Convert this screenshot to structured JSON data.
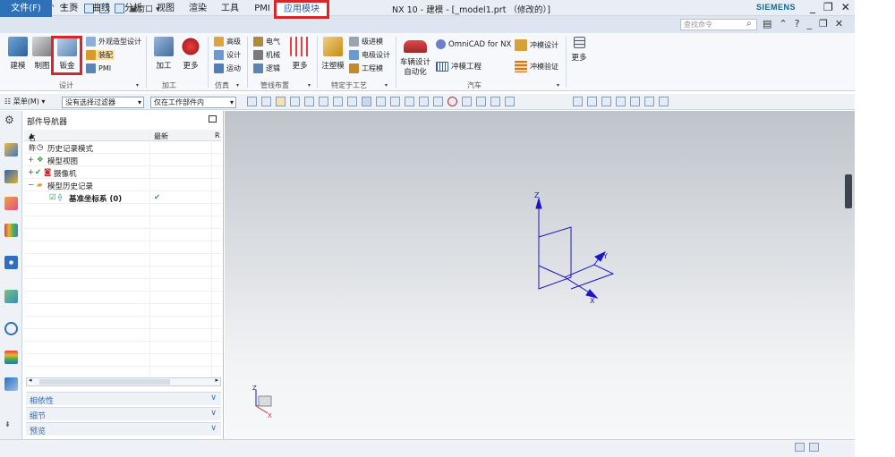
{
  "app": {
    "logo": "NX",
    "window_title": "NX 10 - 建模 - [_model1.prt （修改的）]",
    "brand": "SIEMENS",
    "qat_window_label": "窗口",
    "window_controls": [
      "_",
      "❐",
      "✕"
    ]
  },
  "menu": {
    "file": "文件(F)",
    "tabs": [
      "主页",
      "曲线",
      "分析",
      "视图",
      "渲染",
      "工具",
      "PMI"
    ],
    "active_tab": "应用模块",
    "search_placeholder": "查找命令"
  },
  "ribbon": {
    "design": {
      "big": [
        "建模",
        "制图",
        "钣金"
      ],
      "small": [
        "外观造型设计",
        "装配",
        "PMI"
      ],
      "group_label": "设计"
    },
    "machining": {
      "big": [
        "加工",
        "更多"
      ],
      "group_label": "加工"
    },
    "simulation": {
      "small": [
        "高级",
        "设计",
        "运动"
      ],
      "group_label": "仿真"
    },
    "routing": {
      "small": [
        "电气",
        "机械",
        "逻辑"
      ],
      "big": [
        "更多"
      ],
      "group_label": "管线布置"
    },
    "process": {
      "big": [
        "注塑模"
      ],
      "small": [
        "级进模",
        "电极设计",
        "工程模"
      ],
      "group_label": "特定于工艺"
    },
    "automotive": {
      "big": [
        "车辆设计\n自动化"
      ],
      "small": [
        "OmniCAD for NX",
        "冲模工程",
        "冲模设计",
        "冲模验证"
      ],
      "group_label": "汽车"
    },
    "more": {
      "big": [
        "更多"
      ]
    }
  },
  "selection_bar": {
    "menu": "菜单(M)",
    "filter": "没有选择过滤器",
    "scope": "仅在工作部件内"
  },
  "navigator": {
    "title": "部件导航器",
    "col_name": "名称",
    "col_latest": "最新",
    "col_extra": "R",
    "rows": [
      {
        "label": "历史记录模式",
        "indent": 0
      },
      {
        "label": "模型视图",
        "indent": 0
      },
      {
        "label": "摄像机",
        "indent": 0
      },
      {
        "label": "模型历史记录",
        "indent": 0
      },
      {
        "label": "基准坐标系 (0)",
        "indent": 1,
        "latest": "✔"
      }
    ],
    "panels": [
      "相依性",
      "细节",
      "预览"
    ]
  },
  "axes": {
    "x": "X",
    "y": "Y",
    "z": "Z"
  },
  "colors": {
    "accent": "#2f71b8",
    "highlight": "#d8262b",
    "csys": "#1c16c8"
  }
}
